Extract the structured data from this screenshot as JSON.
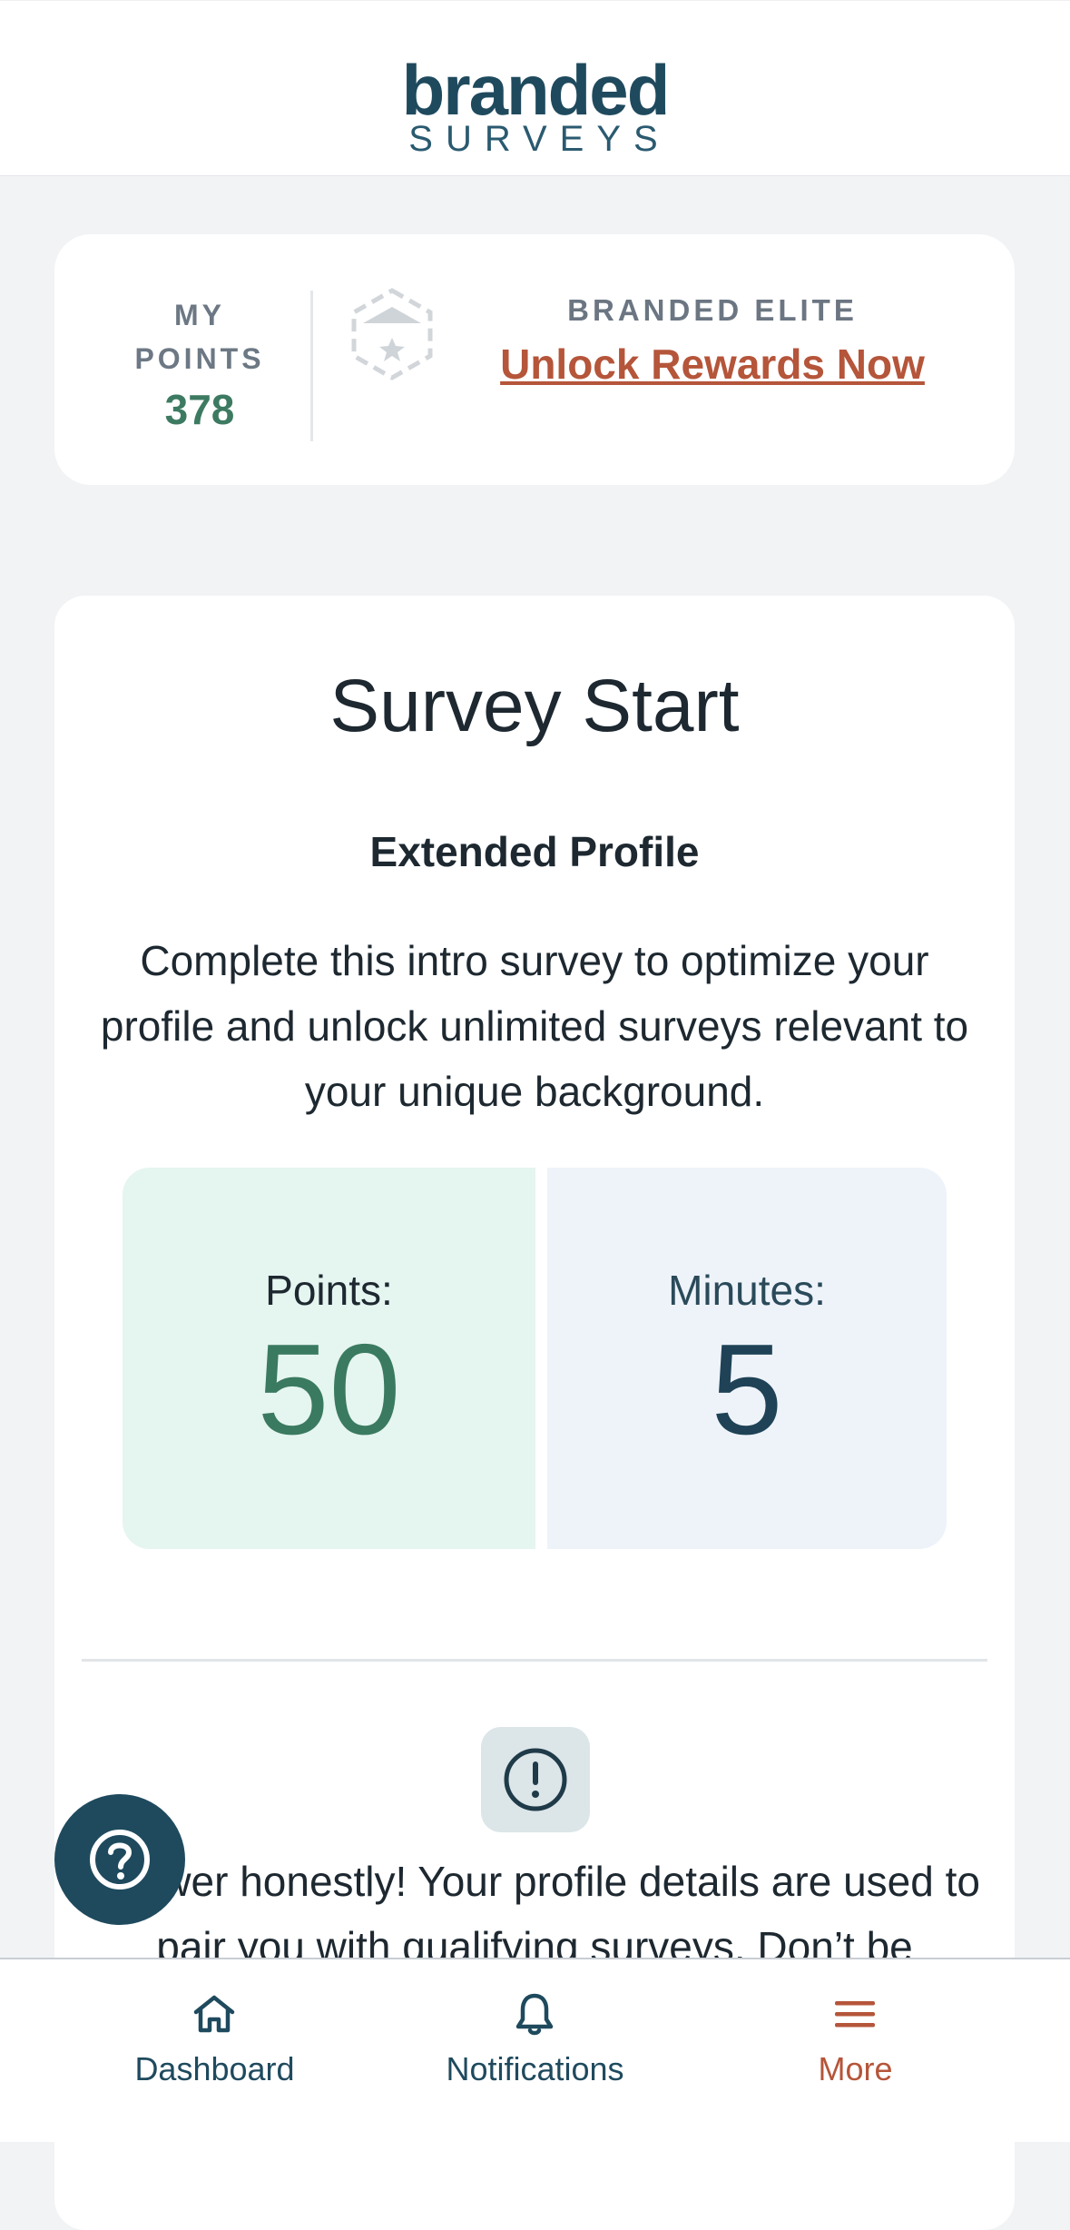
{
  "header": {
    "logo_main": "branded",
    "logo_sub": "SURVEYS"
  },
  "points_card": {
    "my_points_label_1": "MY",
    "my_points_label_2": "POINTS",
    "my_points_value": "378",
    "elite_label": "BRANDED ELITE",
    "elite_link": "Unlock Rewards Now"
  },
  "survey": {
    "title": "Survey Start",
    "subtitle": "Extended Profile",
    "description": "Complete this intro survey to optimize your profile and unlock unlimited surveys relevant to your unique background.",
    "points_label": "Points:",
    "points_value": "50",
    "minutes_label": "Minutes:",
    "minutes_value": "5",
    "notice_text": "Answer honestly! Your profile details are used to pair you with qualifying surveys. Don’t be"
  },
  "bottom_nav": {
    "items": [
      {
        "label": "Dashboard",
        "icon": "home-icon"
      },
      {
        "label": "Notifications",
        "icon": "bell-icon"
      },
      {
        "label": "More",
        "icon": "menu-icon"
      }
    ]
  },
  "colors": {
    "brand": "#1f4a5e",
    "accent": "#b5553a",
    "points_green": "#3a7a60"
  }
}
